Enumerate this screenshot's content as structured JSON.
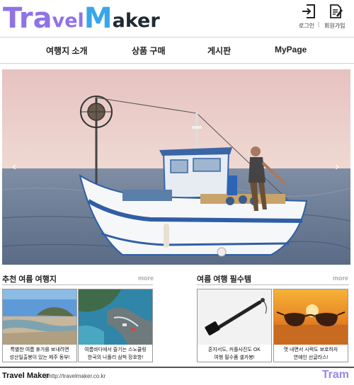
{
  "header": {
    "logo": {
      "p1": "Tra",
      "p2": "vel",
      "p3": "M",
      "p4": "aker"
    },
    "links": {
      "login": "로그인",
      "sep": "|",
      "join": "회원가입"
    }
  },
  "nav": {
    "items": [
      "여행지 소개",
      "상품 구매",
      "게시판",
      "MyPage"
    ]
  },
  "hero": {
    "prev_icon": "‹",
    "next_icon": "›"
  },
  "sections": {
    "left": {
      "title": "추천 여름 여행지",
      "more": "more"
    },
    "right": {
      "title": "여름 여행 필수템",
      "more": "more"
    }
  },
  "cards": [
    {
      "line1": "특별한 여름 휴가를 보내려면",
      "line2": "성산일출봉이 있는 제주 동부!"
    },
    {
      "line1": "여름바다에서 즐기는 스노쿨링",
      "line2": "한국의 나폴리 삼척 장호항!"
    },
    {
      "line1": "혼자서도, 커플사진도 OK",
      "line2": "여행 필수품 셀카봉!"
    },
    {
      "line1": "맷 내면서 시력도 보호하자",
      "line2": "연예인 선글라스!"
    }
  ],
  "footer": {
    "brand": "Travel Maker",
    "url": "| http://travelmaker.co.kr",
    "tram": "Tram"
  },
  "colors": {
    "logo_purple": "#8f72e9",
    "logo_blue": "#38a6ec",
    "logo_dark": "#1f2a33"
  },
  "icons": [
    "login-icon",
    "join-icon",
    "chevron-left-icon",
    "chevron-right-icon"
  ]
}
